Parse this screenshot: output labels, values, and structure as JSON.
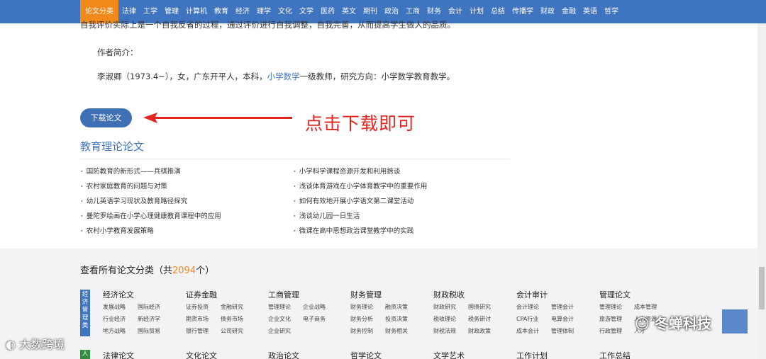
{
  "nav": {
    "items": [
      {
        "label": "论文分类"
      },
      {
        "label": "法律"
      },
      {
        "label": "工学"
      },
      {
        "label": "管理"
      },
      {
        "label": "计算机"
      },
      {
        "label": "教育"
      },
      {
        "label": "经济"
      },
      {
        "label": "理学"
      },
      {
        "label": "文化"
      },
      {
        "label": "文学"
      },
      {
        "label": "医药"
      },
      {
        "label": "英文"
      },
      {
        "label": "期刊"
      },
      {
        "label": "政治"
      },
      {
        "label": "工商"
      },
      {
        "label": "财务"
      },
      {
        "label": "会计"
      },
      {
        "label": "计划"
      },
      {
        "label": "总结"
      },
      {
        "label": "传播学"
      },
      {
        "label": "财政"
      },
      {
        "label": "金融"
      },
      {
        "label": "英语"
      },
      {
        "label": "哲学"
      }
    ]
  },
  "article": {
    "cut_line": "自我评价实际上是一个自我反省的过程，通过评价进行自我调整，自我完善，从而提高学生做人的品质。",
    "author_label": "作者简介：",
    "bio_pre": "李淑卿（1973.4~），女，广东开平人，本科，",
    "bio_link": "小学数学",
    "bio_post": "一级教师，研究方向：小学数学教育教学。"
  },
  "download_button": "下载论文",
  "annotation": "点击下载即可",
  "section_title": "教育理论论文",
  "papers_left": [
    "国防教育的新形式——兵棋推演",
    "农村家庭教育的问题与对策",
    "幼儿英语学习现状及教育路径探究",
    "曼陀罗绘画在小学心理健康教育课程中的应用",
    "农村小学教育发展策略"
  ],
  "papers_right": [
    "小学科学课程资源开发和利用摭谈",
    "浅谈体育游戏在小学体育教学中的重要作用",
    "如何有效地开展小学语文第二课堂活动",
    "浅谈幼儿园一日生活",
    "微课在高中思想政治课堂教学中的实践"
  ],
  "all_categories": {
    "prefix": "查看所有论文分类（共",
    "count": "2094",
    "suffix": "个）"
  },
  "vtab": "经济管理类",
  "vtab2": "人",
  "categories": [
    {
      "title": "经济论文",
      "items": [
        "发展战略",
        "国际经济",
        "行业经济",
        "新经济学",
        "地方战略",
        "国际贸易"
      ]
    },
    {
      "title": "证券金融",
      "items": [
        "证券投资",
        "金融研究",
        "期货市场",
        "债务市场",
        "银行管理",
        "公司研究"
      ]
    },
    {
      "title": "工商管理",
      "items": [
        "管理理论",
        "企业战略",
        "企业文化",
        "电子商务",
        "企业研究",
        ""
      ]
    },
    {
      "title": "财务管理",
      "items": [
        "财务理论",
        "融资决策",
        "财务分析",
        "投资决策",
        "财务控制",
        "财务相关"
      ]
    },
    {
      "title": "财政税收",
      "items": [
        "财政研究",
        "国债研究",
        "税收理论",
        "税务研讨",
        "财税法规",
        "财政政策"
      ]
    },
    {
      "title": "会计审计",
      "items": [
        "会计理论",
        "管理会计",
        "CPA行业",
        "电算会计",
        "成本会计",
        "管理体制"
      ]
    },
    {
      "title": "管理论文",
      "items": [
        "管理理论",
        "成本管理",
        "旅游管理",
        "人力资源",
        "行政管理",
        "人才"
      ]
    }
  ],
  "categories2": [
    "法律论文",
    "文化论文",
    "政治论文",
    "哲学论文",
    "文学艺术",
    "工作计划",
    "工作总结"
  ],
  "watermark_left": "大数跨境",
  "watermark_right": "冬蝉科技"
}
